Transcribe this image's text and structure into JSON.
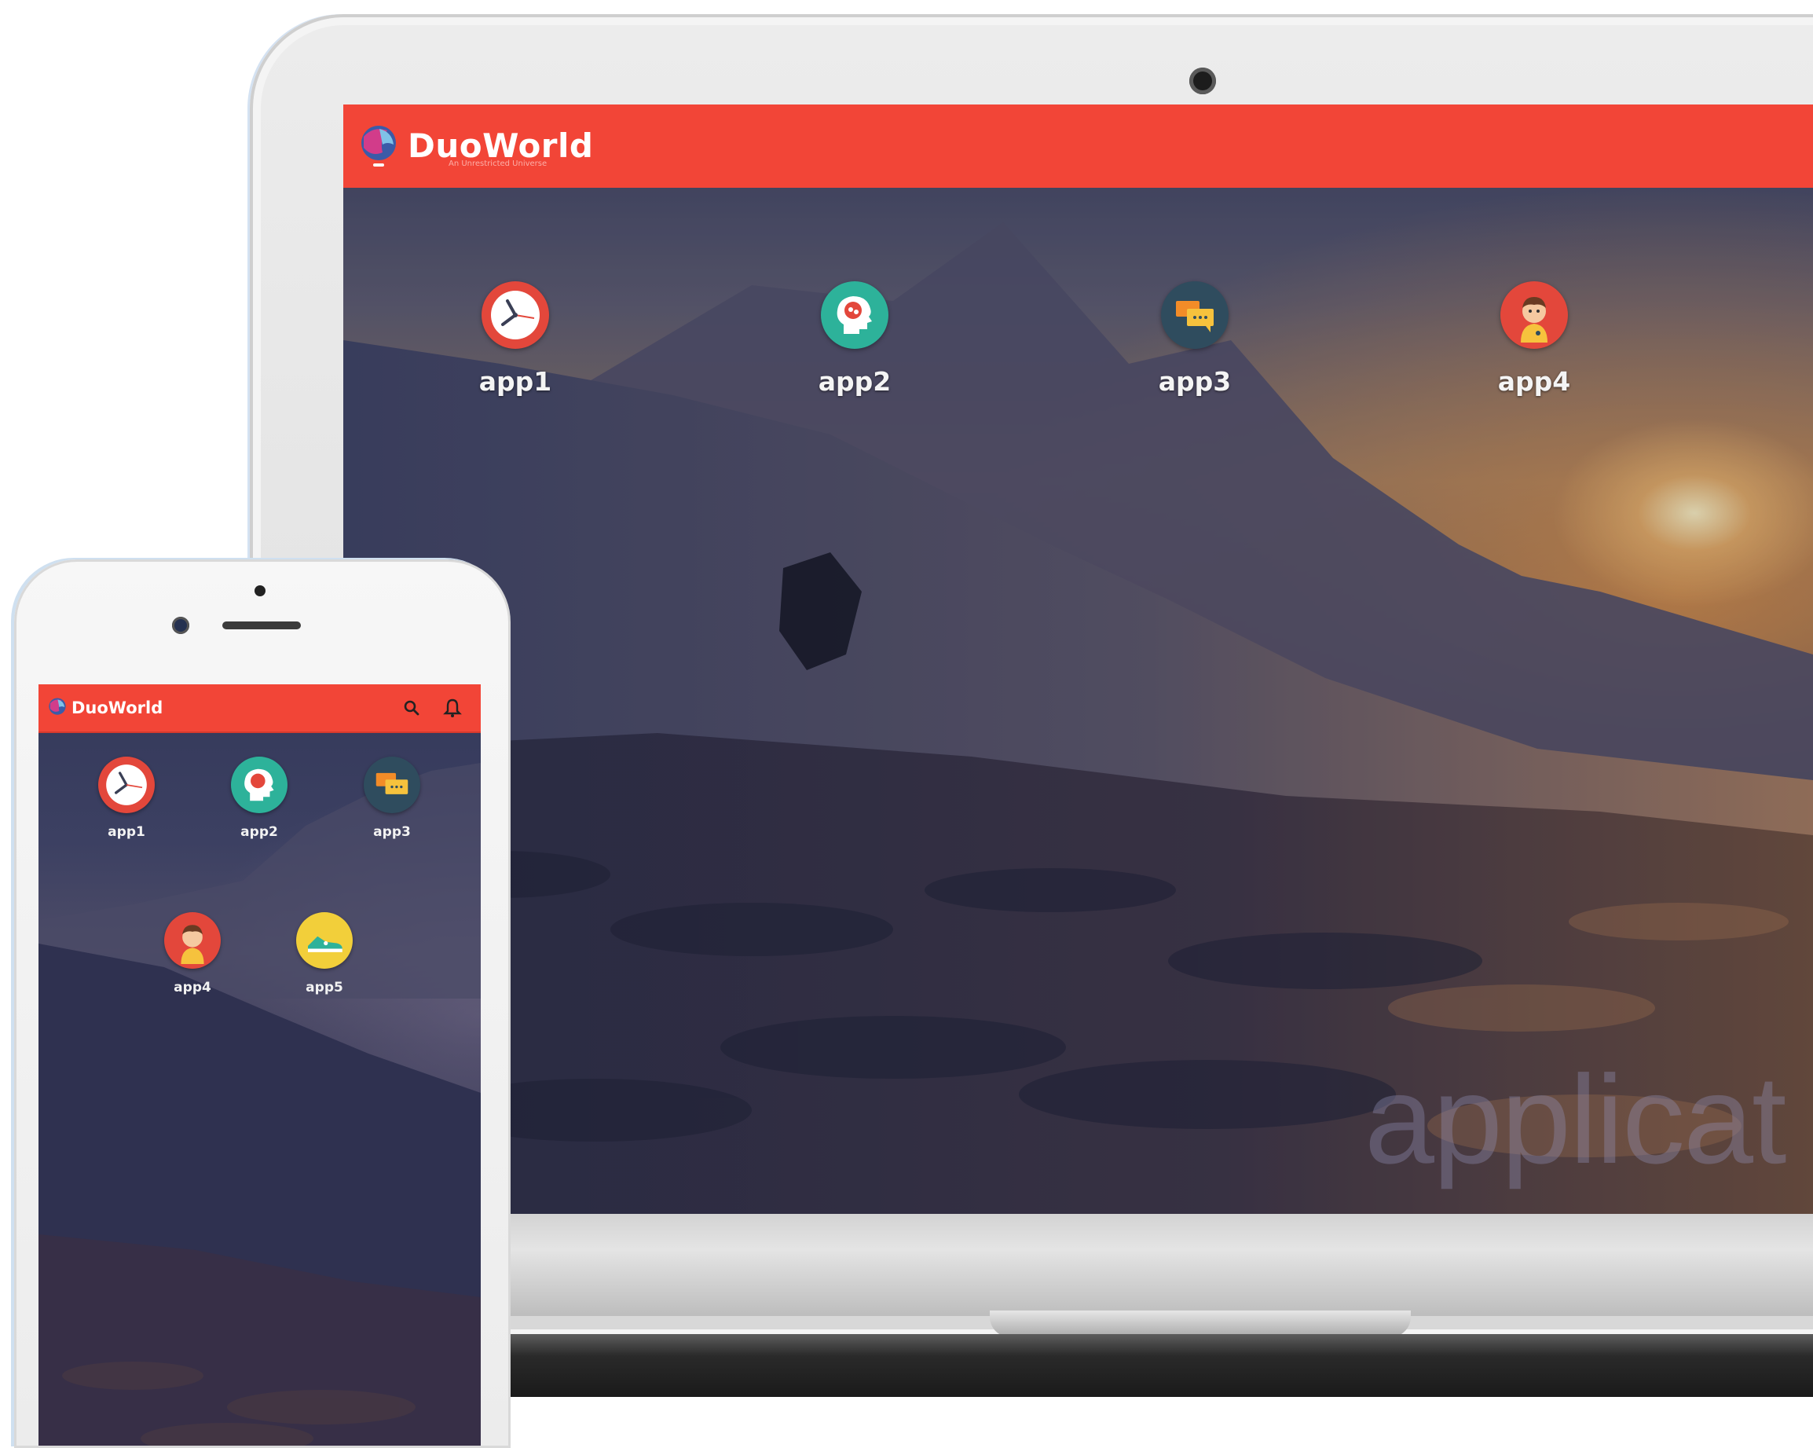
{
  "brand": {
    "name": "DuoWorld",
    "tagline": "An Unrestricted Universe",
    "accent": "#f24537"
  },
  "desktop": {
    "apps": [
      {
        "label": "app1",
        "icon": "clock-icon"
      },
      {
        "label": "app2",
        "icon": "brain-icon"
      },
      {
        "label": "app3",
        "icon": "chat-icon"
      },
      {
        "label": "app4",
        "icon": "avatar-icon"
      }
    ],
    "watermark": "applicat"
  },
  "mobile": {
    "actions": [
      {
        "name": "search-icon"
      },
      {
        "name": "bell-icon"
      }
    ],
    "apps": [
      {
        "label": "app1",
        "icon": "clock-icon"
      },
      {
        "label": "app2",
        "icon": "brain-icon"
      },
      {
        "label": "app3",
        "icon": "chat-icon"
      },
      {
        "label": "app4",
        "icon": "avatar-icon"
      },
      {
        "label": "app5",
        "icon": "shoe-icon"
      }
    ]
  }
}
